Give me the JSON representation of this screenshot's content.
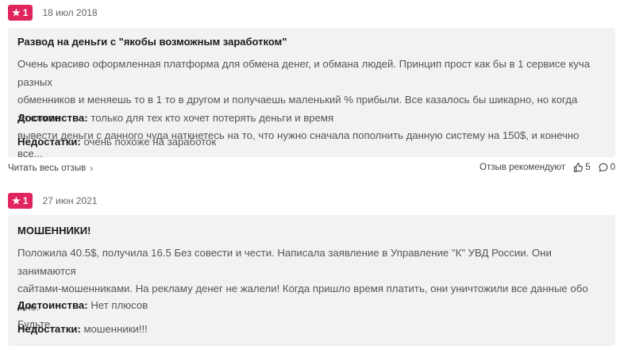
{
  "reviews": [
    {
      "rating": "1",
      "date": "18 июл 2018",
      "title": "Развод на деньги с \"якобы возможным заработком\"",
      "body_lines": [
        "Очень красиво оформленная платформа для обмена денег, и обмана людей. Принцип прост как бы в 1 сервисе куча разных",
        "обменников и меняешь то в 1 то в другом и получаешь маленький % прибыли. Все казалось бы шикарно, но когда захотите",
        "вывести деньги с данного чуда наткнетесь на то, что нужно сначала пополнить данную систему на 150$, и конечно все..."
      ],
      "pros_label": "Достоинства:",
      "pros": "только для тех кто хочет потерять деньги и время",
      "cons_label": "Недостатки:",
      "cons": "очень похоже на заработок",
      "read_all": "Читать весь отзыв",
      "recommend": "Отзыв рекомендуют",
      "likes": "5",
      "comments": "0"
    },
    {
      "rating": "1",
      "date": "27 июн 2021",
      "title": "МОШЕННИКИ!",
      "body_lines": [
        "Положила 40.5$, получила 16.5 Без совести и чести. Написала заявление в Управление \"К\" УВД России. Они занимаются",
        "сайтами-мошенниками. На рекламу денег не жалели! Когда пришло время платить, они уничтожили все данные обо мне.",
        "Будьте..."
      ],
      "pros_label": "Достоинства:",
      "pros": "Нет плюсов",
      "cons_label": "Недостатки:",
      "cons": "мошенники!!!"
    }
  ],
  "colors": {
    "rating_badge": "#e0245e",
    "card_bg": "#f2f2f2"
  },
  "icons": {
    "star": "star-icon",
    "chevron": "chevron-right-icon",
    "thumb": "thumbs-up-icon",
    "comment": "comment-icon"
  }
}
